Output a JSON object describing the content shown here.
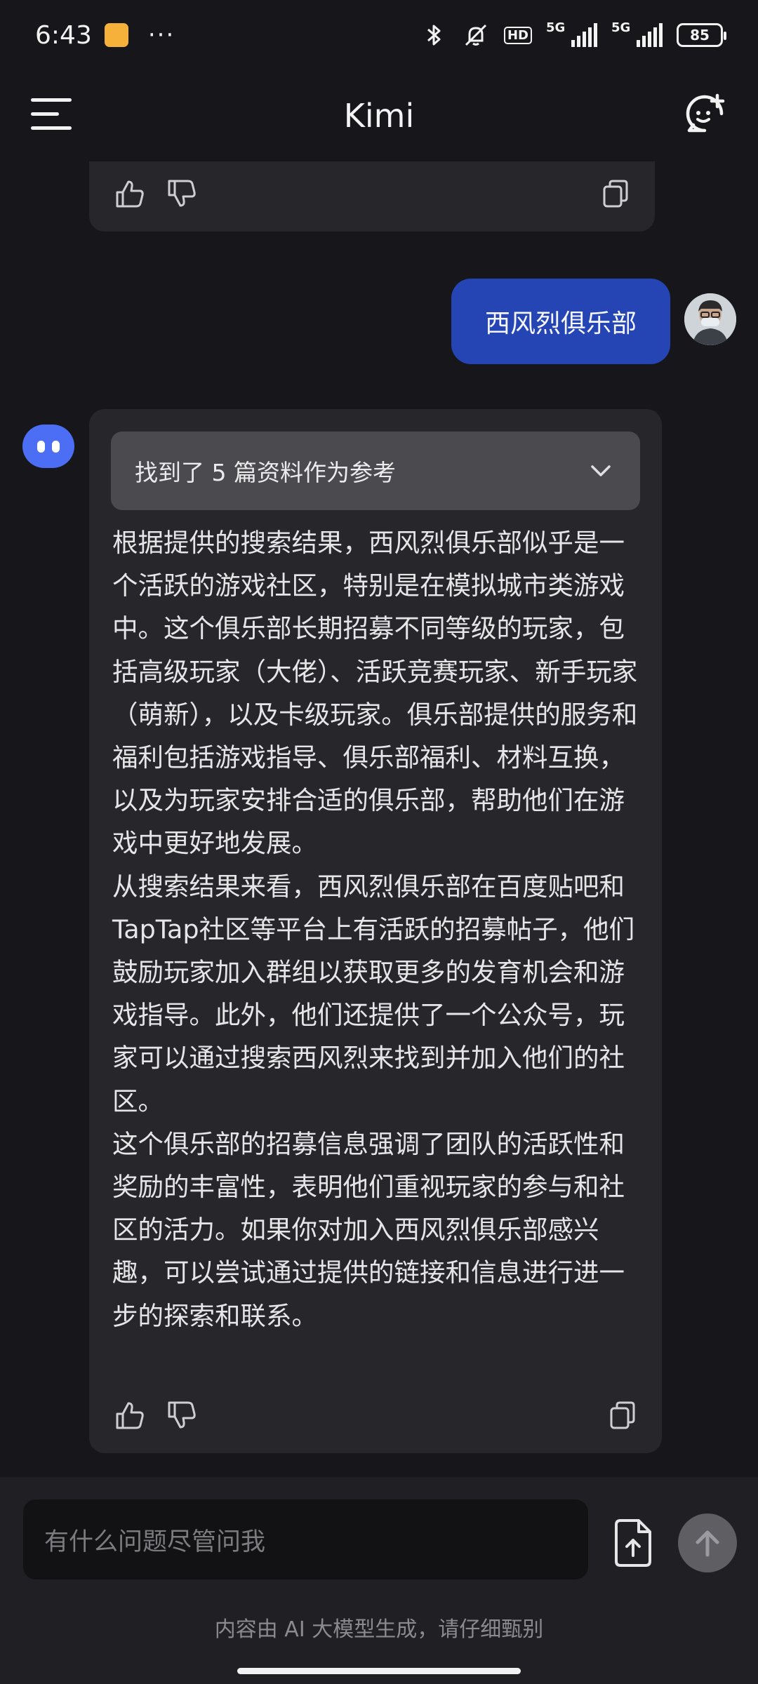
{
  "status_bar": {
    "time": "6:43",
    "dots": "···",
    "hd_label": "HD",
    "network_1": "5G",
    "network_2": "5G",
    "battery": "85"
  },
  "header": {
    "title": "Kimi"
  },
  "conversation": {
    "user_message": "西风烈俱乐部",
    "references_label": "找到了 5 篇资料作为参考",
    "answer_paragraphs": [
      "根据提供的搜索结果，西风烈俱乐部似乎是一个活跃的游戏社区，特别是在模拟城市类游戏中。这个俱乐部长期招募不同等级的玩家，包括高级玩家（大佬）、活跃竞赛玩家、新手玩家（萌新），以及卡级玩家。俱乐部提供的服务和福利包括游戏指导、俱乐部福利、材料互换，以及为玩家安排合适的俱乐部，帮助他们在游戏中更好地发展。",
      "从搜索结果来看，西风烈俱乐部在百度贴吧和TapTap社区等平台上有活跃的招募帖子，他们鼓励玩家加入群组以获取更多的发育机会和游戏指导。此外，他们还提供了一个公众号，玩家可以通过搜索西风烈来找到并加入他们的社区。",
      "这个俱乐部的招募信息强调了团队的活跃性和奖励的丰富性，表明他们重视玩家的参与和社区的活力。如果你对加入西风烈俱乐部感兴趣，可以尝试通过提供的链接和信息进行进一步的探索和联系。"
    ]
  },
  "composer": {
    "placeholder": "有什么问题尽管问我",
    "disclaimer": "内容由 AI 大模型生成，请仔细甄别"
  },
  "colors": {
    "background": "#17171b",
    "card": "#26262b",
    "user_bubble": "#2545b4",
    "bot_avatar": "#4c6ef5"
  }
}
